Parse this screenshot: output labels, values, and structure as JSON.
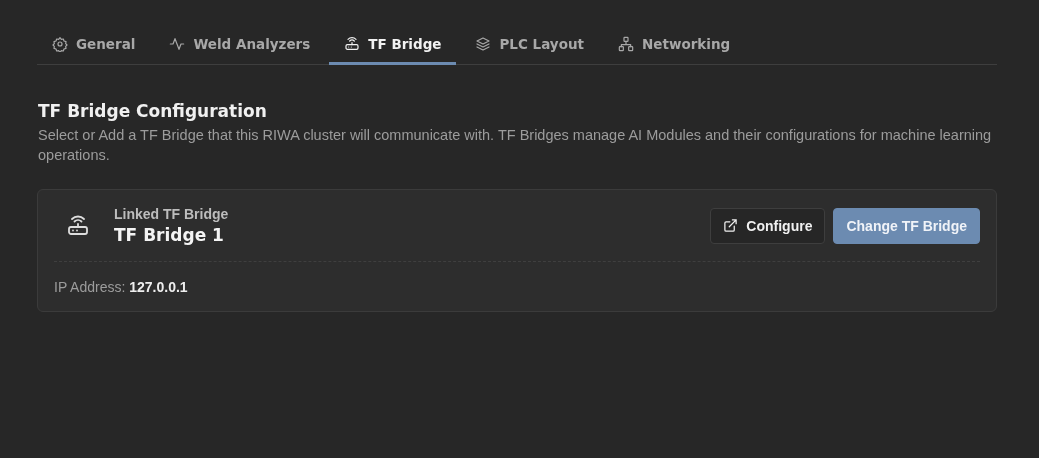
{
  "tabs": [
    {
      "label": "General",
      "selected": false
    },
    {
      "label": "Weld Analyzers",
      "selected": false
    },
    {
      "label": "TF Bridge",
      "selected": true
    },
    {
      "label": "PLC Layout",
      "selected": false
    },
    {
      "label": "Networking",
      "selected": false
    }
  ],
  "section": {
    "title": "TF Bridge Configuration",
    "description": "Select or Add a TF Bridge that this RIWA cluster will communicate with. TF Bridges manage AI Modules and their configurations for machine learning operations."
  },
  "card": {
    "caption": "Linked TF Bridge",
    "name": "TF Bridge 1",
    "buttons": [
      {
        "label": "Configure",
        "kind": "outline"
      },
      {
        "label": "Change TF Bridge",
        "kind": "primary"
      }
    ],
    "ip_label": "IP Address:",
    "ip_value": "127.0.0.1"
  }
}
